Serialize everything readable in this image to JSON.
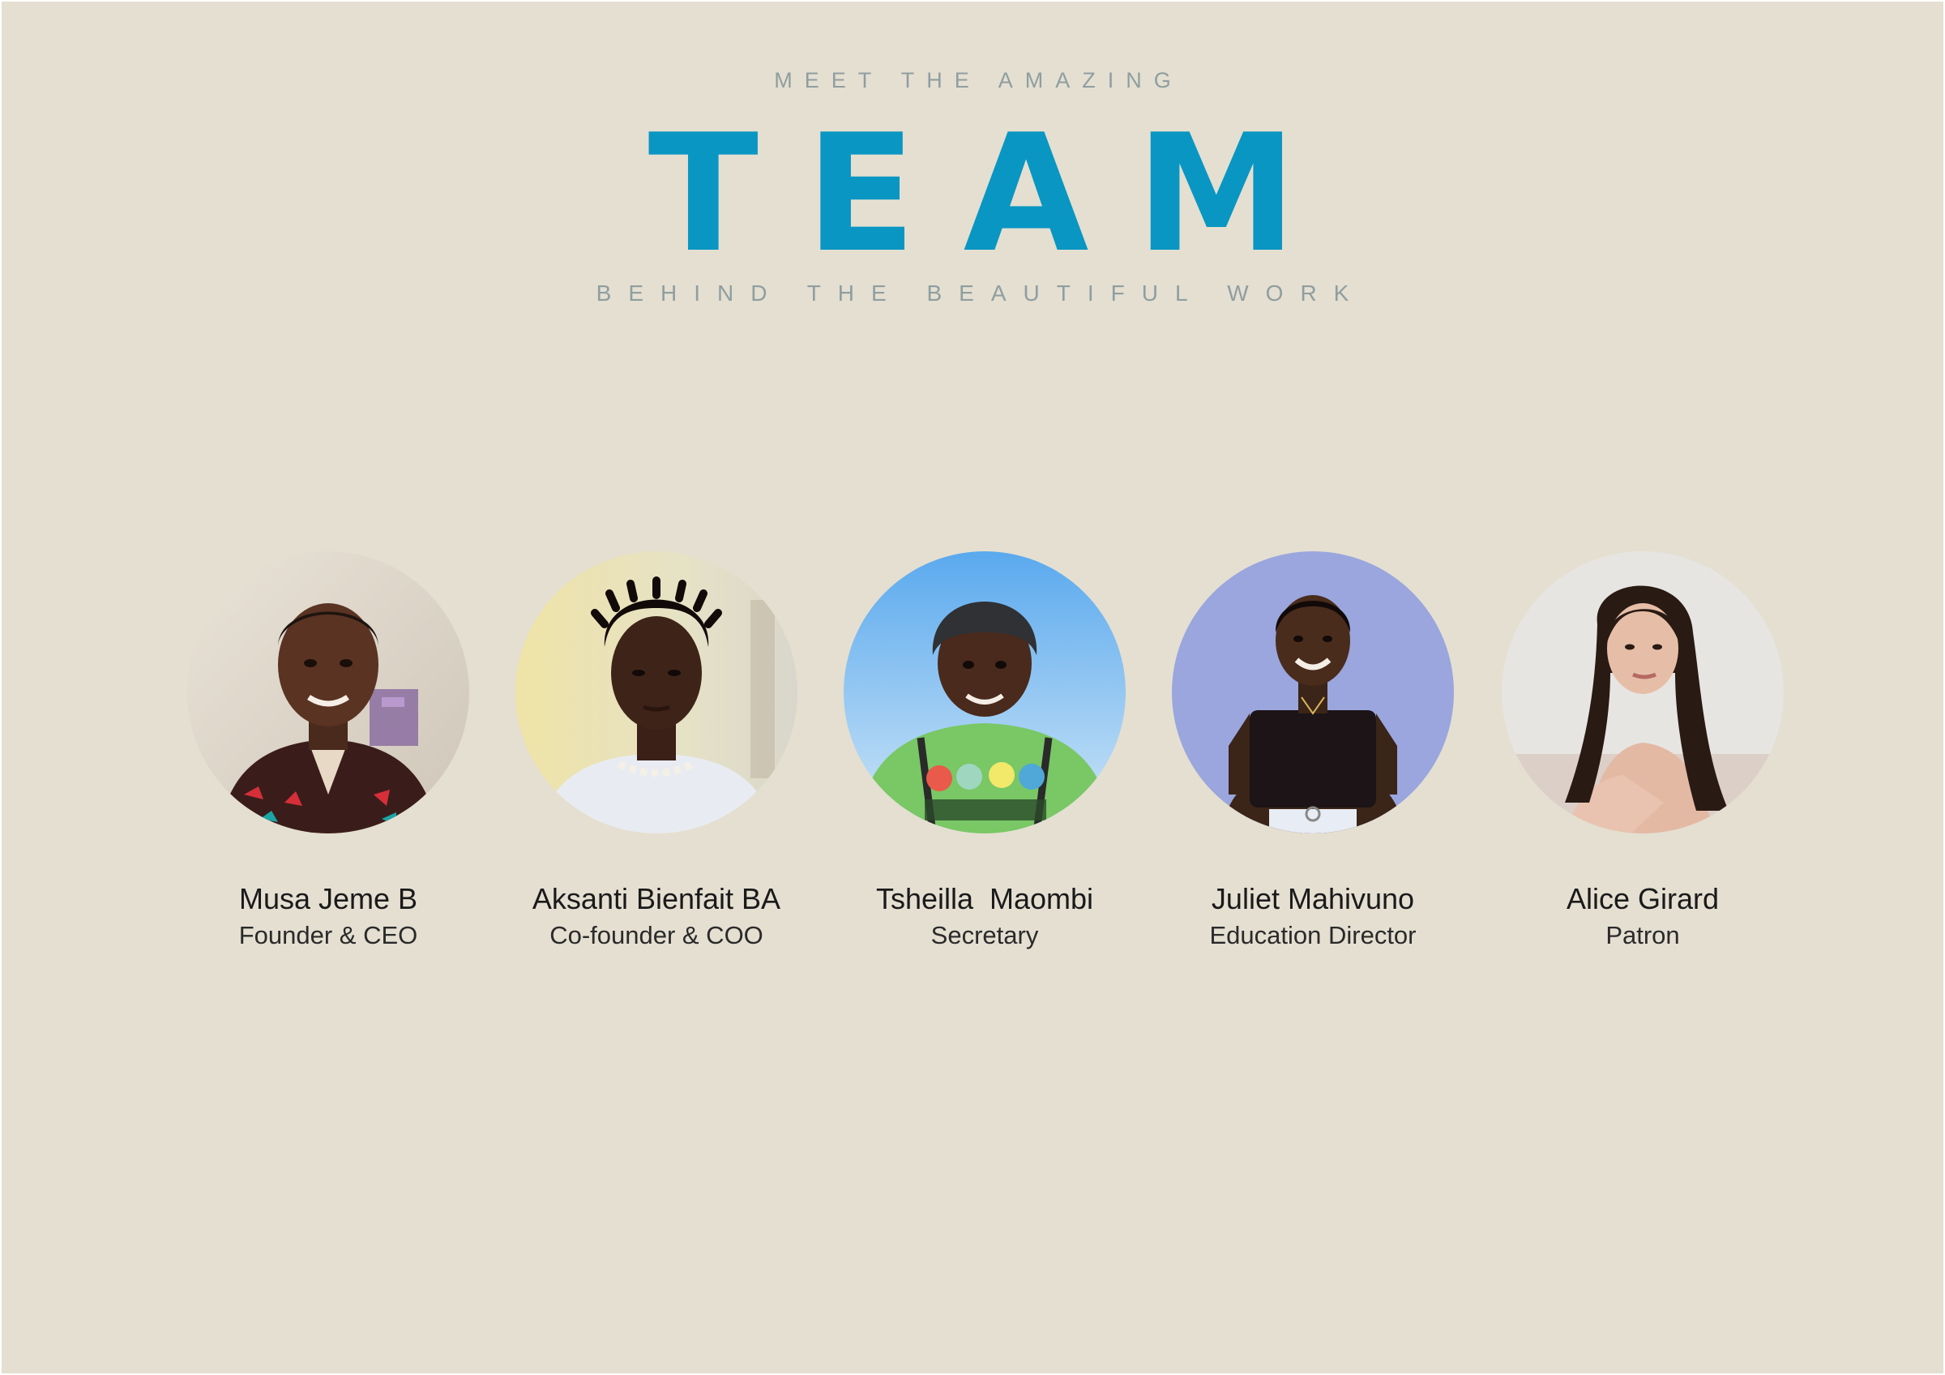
{
  "header": {
    "kicker": "MEET THE AMAZING",
    "title": "TEAM",
    "subtitle": "BEHIND THE BEAUTIFUL WORK"
  },
  "colors": {
    "background": "#e4dfd1",
    "title": "#0996c3",
    "tagline": "#8f9ea0"
  },
  "team": [
    {
      "name": "Musa Jeme B",
      "role": "Founder & CEO"
    },
    {
      "name": "Aksanti Bienfait BA",
      "role": "Co-founder & COO"
    },
    {
      "name": "Tsheilla  Maombi",
      "role": "Secretary"
    },
    {
      "name": "Juliet Mahivuno",
      "role": "Education Director"
    },
    {
      "name": "Alice Girard",
      "role": "Patron"
    }
  ]
}
